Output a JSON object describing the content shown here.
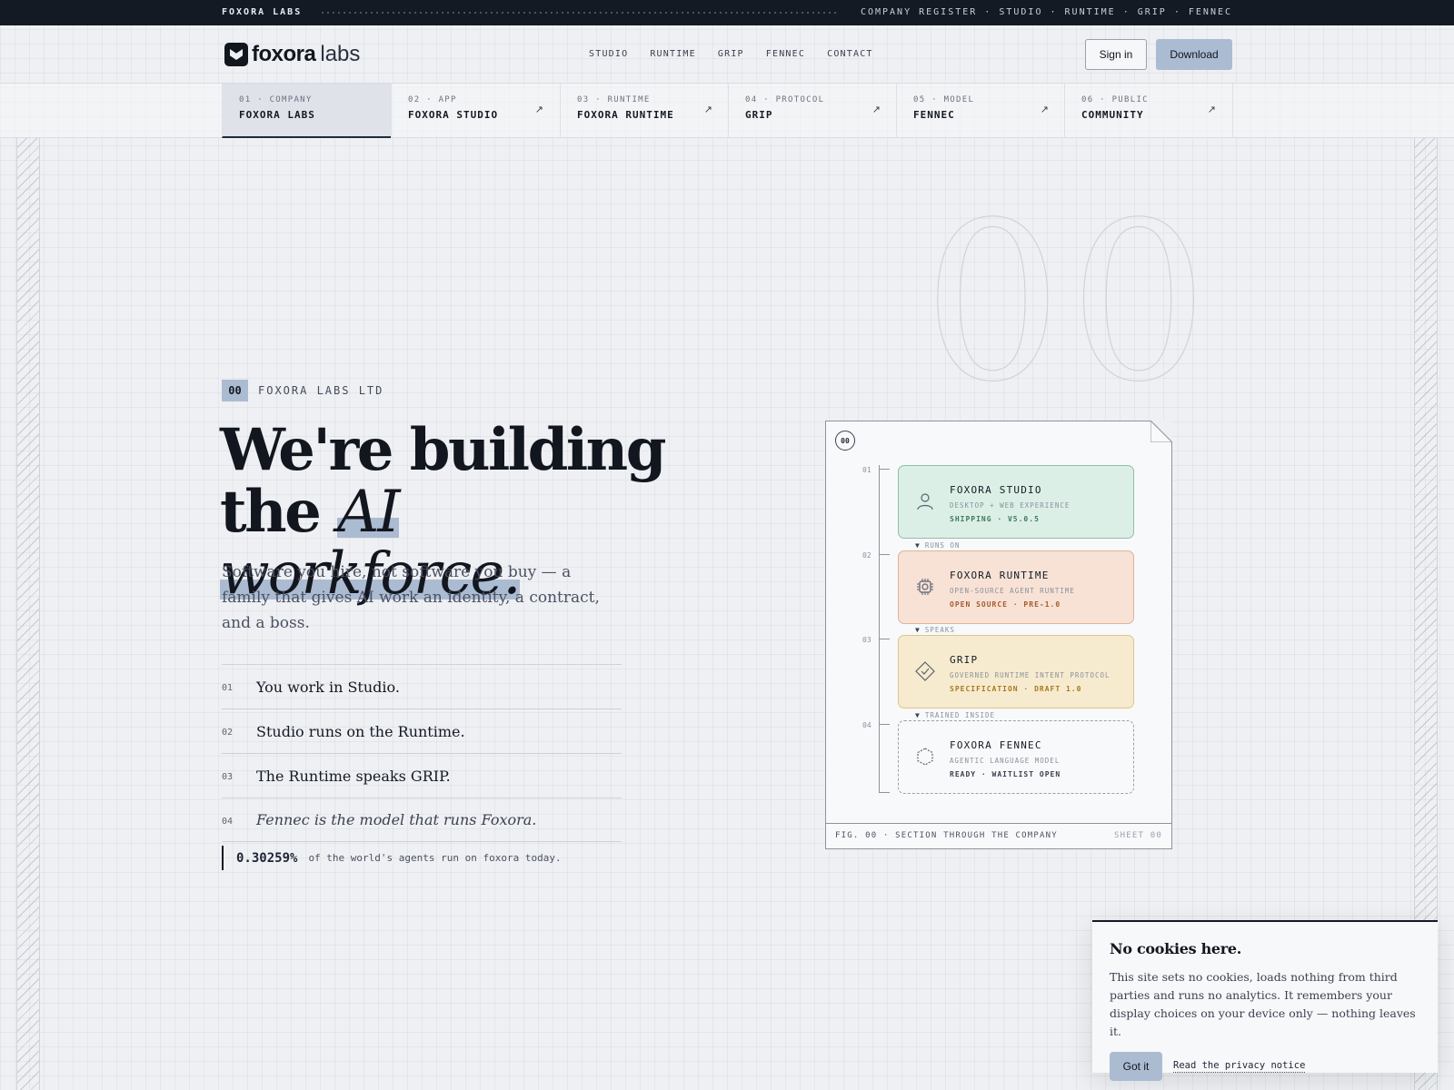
{
  "topstrip": {
    "brand": "FOXORA LABS",
    "links": "COMPANY REGISTER · STUDIO · RUNTIME · GRIP · FENNEC"
  },
  "nav": {
    "logo_bold": "foxora",
    "logo_light": "labs",
    "links": [
      "STUDIO",
      "RUNTIME",
      "GRIP",
      "FENNEC",
      "CONTACT"
    ],
    "signin": "Sign in",
    "download": "Download"
  },
  "tabs": [
    {
      "num": "01 · COMPANY",
      "name": "FOXORA LABS"
    },
    {
      "num": "02 · APP",
      "name": "FOXORA STUDIO",
      "arrow": "↗"
    },
    {
      "num": "03 · RUNTIME",
      "name": "FOXORA RUNTIME",
      "arrow": "↗"
    },
    {
      "num": "04 · PROTOCOL",
      "name": "GRIP",
      "arrow": "↗"
    },
    {
      "num": "05 · MODEL",
      "name": "FENNEC",
      "arrow": "↗"
    },
    {
      "num": "06 · PUBLIC",
      "name": "COMMUNITY",
      "arrow": "↗"
    }
  ],
  "hero": {
    "chip": "00",
    "eyebrow": "FOXORA LABS LTD",
    "headline_line1": "We're building",
    "headline_line2a": "the ",
    "headline_em": "AI workforce.",
    "subtext": "Software you hire, not software you buy — a family that gives AI work an identity, a contract, and a boss.",
    "steps": [
      {
        "n": "01",
        "t": "You work in Studio."
      },
      {
        "n": "02",
        "t": "Studio runs on the Runtime."
      },
      {
        "n": "03",
        "t": "The Runtime speaks GRIP."
      },
      {
        "n": "04",
        "t": "Fennec is the model that runs Foxora."
      }
    ],
    "stat_value": "0.30259%",
    "stat_caption": "of the world's agents run on foxora today."
  },
  "bigzero": "00",
  "diagram": {
    "index": "00",
    "cards": [
      {
        "no": "01",
        "title": "FOXORA STUDIO",
        "desc": "DESKTOP + WEB EXPERIENCE",
        "status": "SHIPPING · V5.0.5",
        "icon": "person-icon"
      },
      {
        "no": "02",
        "title": "FOXORA RUNTIME",
        "desc": "OPEN-SOURCE AGENT RUNTIME",
        "status": "OPEN SOURCE · PRE-1.0",
        "icon": "chip-icon"
      },
      {
        "no": "03",
        "title": "GRIP",
        "desc": "GOVERNED RUNTIME INTENT PROTOCOL",
        "status": "SPECIFICATION · DRAFT 1.0",
        "icon": "diamond-check-icon"
      },
      {
        "no": "04",
        "title": "FOXORA FENNEC",
        "desc": "AGENTIC LANGUAGE MODEL",
        "status": "READY · WAITLIST OPEN",
        "icon": "hexagon-icon"
      }
    ],
    "connectors": [
      "RUNS ON",
      "SPEAKS",
      "TRAINED INSIDE"
    ],
    "caption": "FIG. 00 · SECTION THROUGH THE COMPANY",
    "sheet": "SHEET 00"
  },
  "cookie": {
    "title": "No cookies here.",
    "body": "This site sets no cookies, loads nothing from third parties and runs no analytics. It remembers your display choices on your device only — nothing leaves it.",
    "accept": "Got it",
    "link": "Read the privacy notice"
  },
  "colors": {
    "accent": "#abbbd1",
    "ink": "#12161e",
    "studio_bg": "#dcefe6",
    "runtime_bg": "#f7e2d5",
    "grip_bg": "#f7ebcf"
  }
}
